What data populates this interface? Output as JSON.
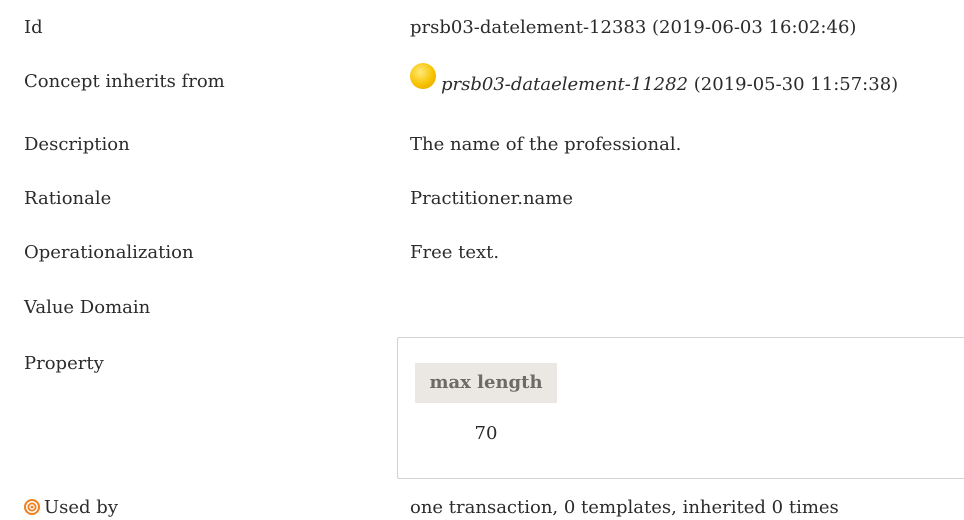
{
  "rows": {
    "id": {
      "label": "Id",
      "value": "prsb03-datelement-12383 (2019-06-03 16:02:46)"
    },
    "inherits": {
      "label": "Concept inherits from",
      "ref": "prsb03-dataelement-11282",
      "date": "(2019-05-30 11:57:38)",
      "icon": "yellow-circle-icon"
    },
    "description": {
      "label": "Description",
      "value": "The name of the professional."
    },
    "rationale": {
      "label": "Rationale",
      "value": "Practitioner.name"
    },
    "operationalization": {
      "label": "Operationalization",
      "value": "Free text."
    },
    "value_domain": {
      "label": "Value Domain"
    },
    "property": {
      "label": "Property",
      "header": "max length",
      "value": "70"
    },
    "used_by": {
      "label": "Used by",
      "value": "one transaction, 0 templates, inherited 0 times",
      "icon": "target-icon"
    }
  },
  "colors": {
    "text": "#2b2b2b",
    "accent": "#f0801e",
    "bullet": "#f7c300",
    "property_header_bg": "#ebe8e4"
  }
}
